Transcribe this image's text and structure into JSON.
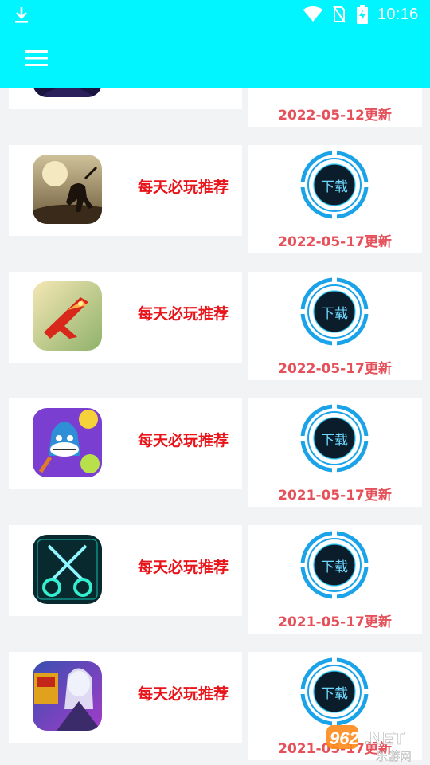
{
  "status_bar": {
    "time": "10:16",
    "icons": [
      "download-icon",
      "wifi-icon",
      "no-sim-icon",
      "battery-charging-icon"
    ]
  },
  "toolbar": {
    "menu_icon": "hamburger-menu-icon"
  },
  "items": [
    {
      "label": "",
      "download_label": "",
      "date": "2022-05-12更新",
      "icon": "orange-flame-game-icon"
    },
    {
      "label": "每天必玩推荐",
      "download_label": "下载",
      "date": "2022-05-17更新",
      "icon": "ninja-silhouette-game-icon"
    },
    {
      "label": "每天必玩推荐",
      "download_label": "下载",
      "date": "2022-05-17更新",
      "icon": "red-fighter-jet-game-icon"
    },
    {
      "label": "每天必玩推荐",
      "download_label": "下载",
      "date": "2021-05-17更新",
      "icon": "cartoon-shark-hero-game-icon"
    },
    {
      "label": "每天必玩推荐",
      "download_label": "下载",
      "date": "2021-05-17更新",
      "icon": "neon-scissors-game-icon"
    },
    {
      "label": "每天必玩推荐",
      "download_label": "下载",
      "date": "2021-05-17更新",
      "icon": "fantasy-warrior-game-icon"
    }
  ],
  "watermark": {
    "text": "962.NET",
    "subtext": "乐游网"
  },
  "colors": {
    "header": "#00f5ff",
    "background": "#f1f3f5",
    "label_red": "#e8141a",
    "date_red": "#e5505a",
    "ring_blue": "#1aa3e8"
  }
}
